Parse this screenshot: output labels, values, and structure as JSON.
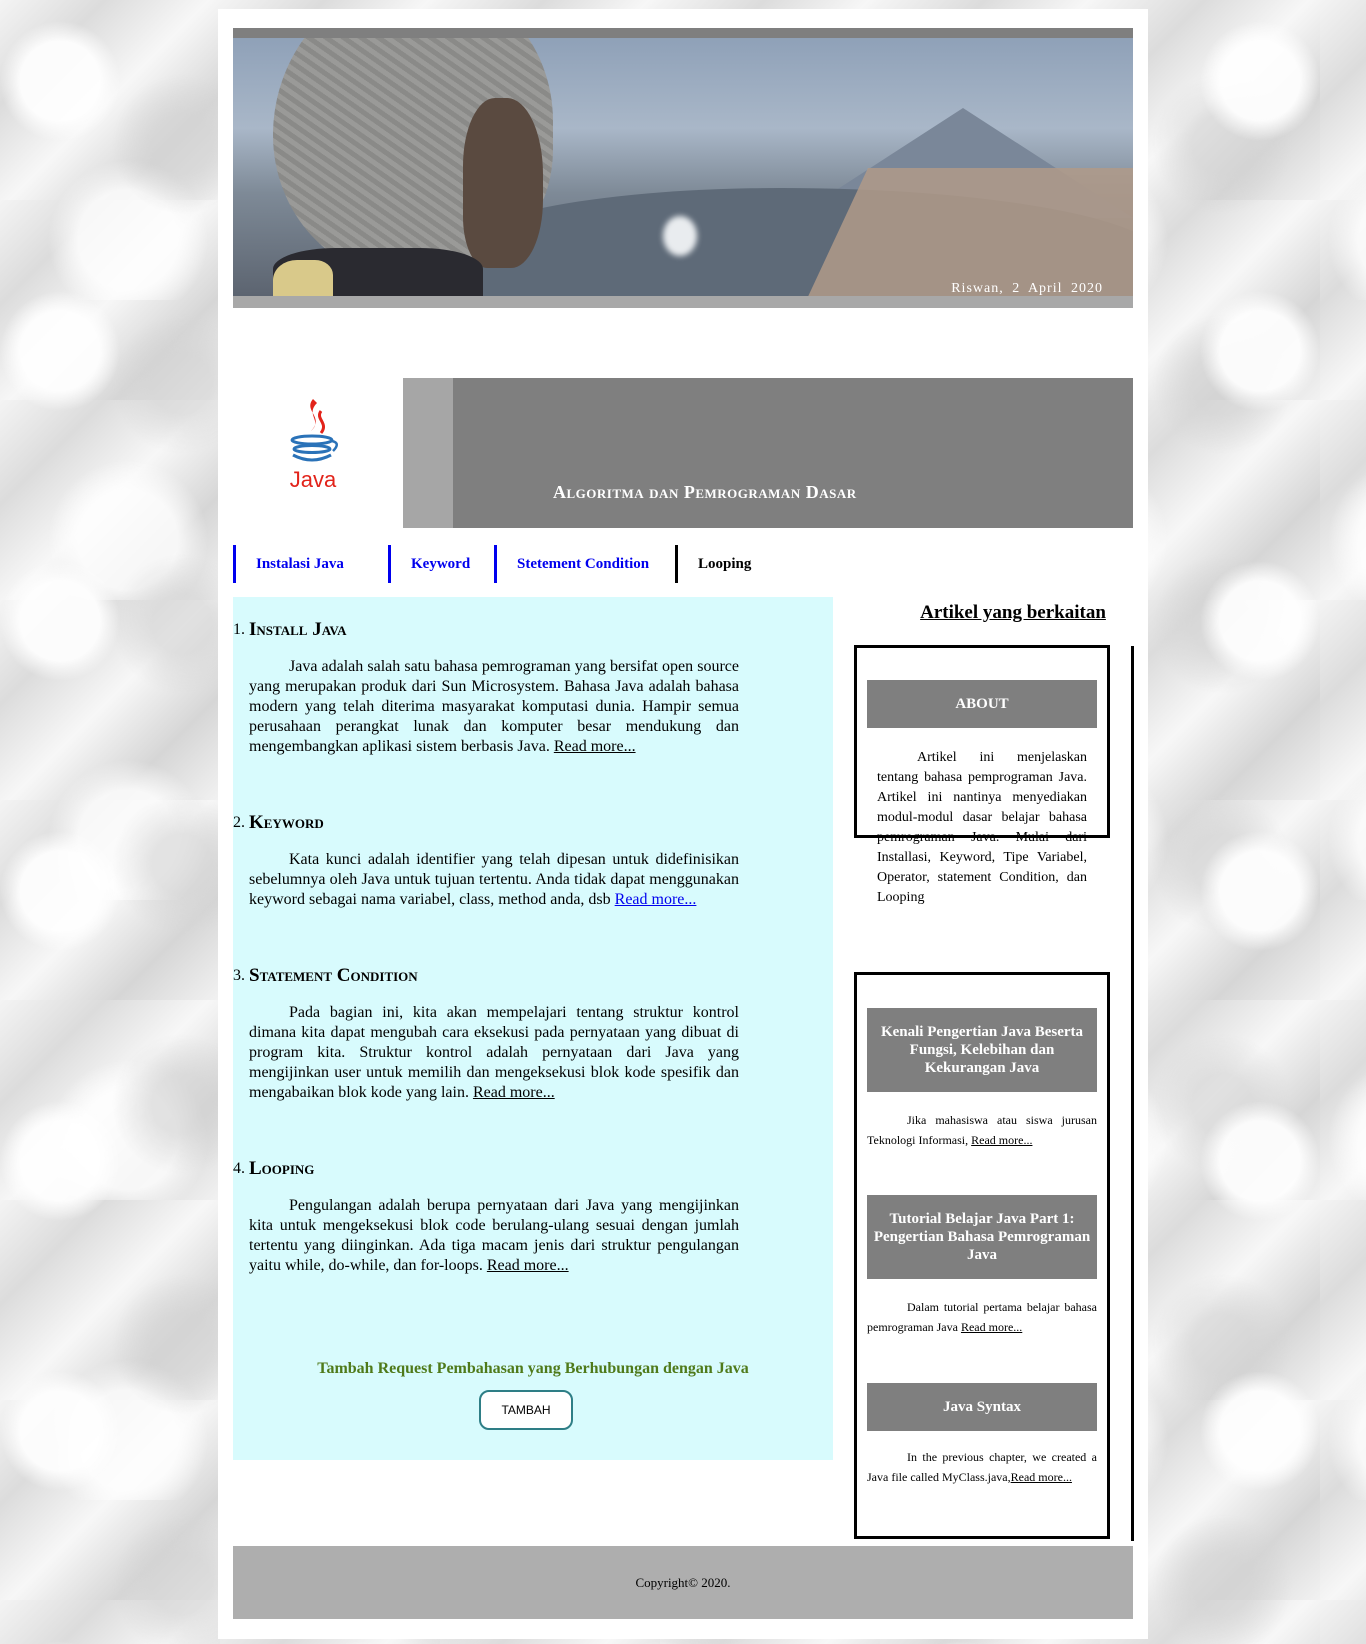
{
  "banner": {
    "caption": "Riswan,  2  April  2020"
  },
  "logo": {
    "text": "Java"
  },
  "header": {
    "title": "Algoritma dan Pemrograman Dasar"
  },
  "nav": {
    "items": [
      {
        "label": "Instalasi Java"
      },
      {
        "label": "Keyword"
      },
      {
        "label": "Stetement Condition"
      },
      {
        "label": "Looping"
      }
    ]
  },
  "articles": [
    {
      "number": "1.",
      "heading": "Install Java",
      "body": "Java adalah salah satu bahasa pemrograman yang bersifat open source yang merupakan produk dari Sun Microsystem. Bahasa Java adalah bahasa modern yang telah diterima masyarakat komputasi dunia. Hampir semua perusahaan perangkat lunak dan komputer besar mendukung dan mengembangkan aplikasi sistem berbasis Java.",
      "read_more": "Read  more..."
    },
    {
      "number": "2.",
      "heading": "Keyword",
      "body": "Kata kunci adalah identifier yang telah dipesan untuk didefinisikan sebelumnya oleh Java untuk tujuan tertentu. Anda tidak dapat menggunakan keyword sebagai nama variabel, class, method anda, dsb",
      "read_more": "Read  more..."
    },
    {
      "number": "3.",
      "heading": "Statement Condition",
      "body": "Pada bagian ini, kita akan mempelajari tentang struktur kontrol dimana kita dapat mengubah cara eksekusi pada pernyataan yang dibuat di program kita. Struktur kontrol adalah pernyataan dari Java yang mengijinkan user untuk memilih dan mengeksekusi blok kode spesifik dan mengabaikan blok kode yang lain.",
      "read_more": "Read  more..."
    },
    {
      "number": "4.",
      "heading": "Looping",
      "body": "Pengulangan adalah berupa pernyataan dari Java yang mengijinkan kita untuk mengeksekusi blok code berulang-ulang sesuai dengan jumlah tertentu yang diinginkan. Ada tiga macam jenis dari struktur pengulangan yaitu while, do-while, dan for-loops.",
      "read_more": "Read  more..."
    }
  ],
  "request": {
    "text": "Tambah Request Pembahasan yang Berhubungan dengan Java",
    "button": "TAMBAH"
  },
  "sidebar": {
    "title": "Artikel yang berkaitan",
    "about": {
      "heading": "ABOUT",
      "text": "Artikel ini menjelaskan tentang bahasa pemprograman Java. Artikel ini nantinya menyediakan modul-modul dasar belajar bahasa pemrograman Java. Mulai dari Installasi, Keyword, Tipe Variabel, Operator, statement Condition, dan Looping"
    },
    "related": [
      {
        "heading": "Kenali Pengertian Java Beserta Fungsi, Kelebihan dan Kekurangan Java",
        "text": "Jika mahasiswa atau siswa jurusan Teknologi Informasi,",
        "read_more": "Read more..."
      },
      {
        "heading": "Tutorial Belajar Java Part 1: Pengertian Bahasa Pemrograman Java",
        "text": "Dalam tutorial pertama belajar bahasa pemrograman Java",
        "read_more": "Read more..."
      },
      {
        "heading": "Java Syntax",
        "text": "In the previous chapter, we created a Java file called MyClass.java,",
        "read_more": "Read  more..."
      }
    ]
  },
  "footer": {
    "text": "Copyright©  2020."
  },
  "colors": {
    "header_gray": "#7f7f7f",
    "content_bg": "#d8fbfd",
    "nav_link": "#0000ee",
    "request_green": "#4f7a1a",
    "footer_gray": "#aeaeae"
  }
}
